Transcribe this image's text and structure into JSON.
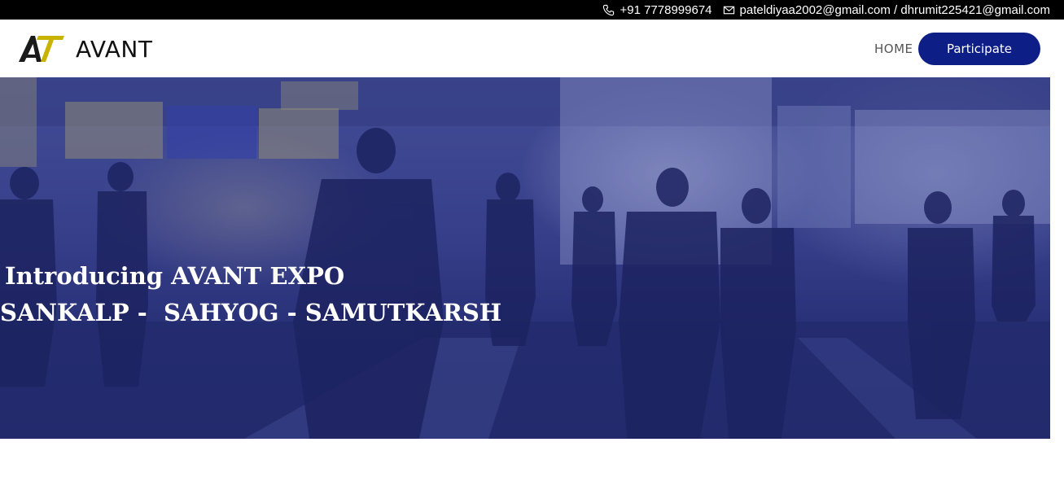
{
  "topbar": {
    "phone": "+91 7778999674",
    "emails": "pateldiyaa2002@gmail.com / dhrumit225421@gmail.com",
    "phone_icon": "phone-icon",
    "email_icon": "envelope-icon"
  },
  "header": {
    "brand": "AVANT",
    "logo_icon": "avant-logo",
    "nav": {
      "home": "HOME"
    },
    "cta": "Participate"
  },
  "hero": {
    "line1": "Introducing AVANT EXPO",
    "line2": "SANKALP -  SAHYOG - SAMUTKARSH",
    "overlay_color": "#2b3377"
  },
  "colors": {
    "accent": "#0d1f86",
    "topbar_bg": "#000000",
    "logo_gold": "#c8b400"
  }
}
